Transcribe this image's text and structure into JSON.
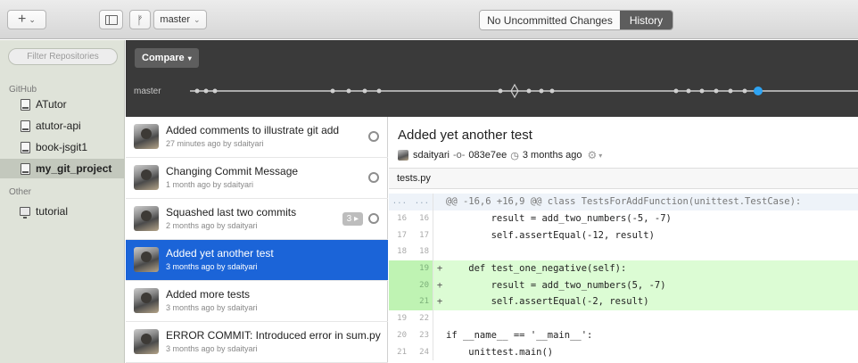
{
  "toolbar": {
    "add_glyph": "+",
    "add_chevron": "⌄",
    "branch_glyph": "ᚠ",
    "branch_name": "master",
    "branch_chevron": "⌄",
    "segments": [
      "No Uncommitted Changes",
      "History"
    ],
    "active_segment": "History"
  },
  "sidebar": {
    "filter_placeholder": "Filter Repositories",
    "sections": [
      {
        "label": "GitHub",
        "repos": [
          "ATutor",
          "atutor-api",
          "book-jsgit1",
          "my_git_project"
        ]
      },
      {
        "label": "Other",
        "repos": [
          "tutorial"
        ]
      }
    ],
    "selected_repo": "my_git_project"
  },
  "timeline": {
    "compare_label": "Compare",
    "compare_chevron": "▾",
    "branch_label": "master"
  },
  "commits": [
    {
      "title": "Added comments to illustrate git add",
      "subtitle": "27 minutes ago by sdaityari"
    },
    {
      "title": "Changing Commit Message",
      "subtitle": "1 month ago by sdaityari"
    },
    {
      "title": "Squashed last two commits",
      "subtitle": "2 months ago by sdaityari",
      "badge": "3 ▸"
    },
    {
      "title": "Added yet another test",
      "subtitle": "3 months ago by sdaityari",
      "selected": true
    },
    {
      "title": "Added more tests",
      "subtitle": "3 months ago by sdaityari"
    },
    {
      "title": "ERROR COMMIT: Introduced error in sum.py",
      "subtitle": "3 months ago by sdaityari"
    }
  ],
  "detail": {
    "title": "Added yet another test",
    "author": "sdaityari",
    "sha_glyph": "-o-",
    "sha": "083e7ee",
    "clock_glyph": "◷",
    "time": "3 months ago",
    "gear_glyph": "⚙",
    "gear_chevron": "▾",
    "file": "tests.py",
    "diff": [
      {
        "type": "hunk",
        "n1": "...",
        "n2": "...",
        "sign": "",
        "code": "@@ -16,6 +16,9 @@ class TestsForAddFunction(unittest.TestCase):"
      },
      {
        "type": "ctx",
        "n1": "16",
        "n2": "16",
        "sign": "",
        "code": "        result = add_two_numbers(-5, -7)"
      },
      {
        "type": "ctx",
        "n1": "17",
        "n2": "17",
        "sign": "",
        "code": "        self.assertEqual(-12, result)"
      },
      {
        "type": "ctx",
        "n1": "18",
        "n2": "18",
        "sign": "",
        "code": ""
      },
      {
        "type": "add",
        "n1": "",
        "n2": "19",
        "sign": "+",
        "code": "    def test_one_negative(self):"
      },
      {
        "type": "add",
        "n1": "",
        "n2": "20",
        "sign": "+",
        "code": "        result = add_two_numbers(5, -7)"
      },
      {
        "type": "add",
        "n1": "",
        "n2": "21",
        "sign": "+",
        "code": "        self.assertEqual(-2, result)"
      },
      {
        "type": "ctx",
        "n1": "19",
        "n2": "22",
        "sign": "",
        "code": ""
      },
      {
        "type": "ctx",
        "n1": "20",
        "n2": "23",
        "sign": "",
        "code": "if __name__ == '__main__':"
      },
      {
        "type": "ctx",
        "n1": "21",
        "n2": "24",
        "sign": "",
        "code": "    unittest.main()"
      }
    ]
  },
  "colors": {
    "selection_blue": "#1b64d8",
    "timeline_bg": "#3a3a3a",
    "current_commit_dot": "#2ea3f2",
    "added_line_bg": "#dcfcd4"
  }
}
